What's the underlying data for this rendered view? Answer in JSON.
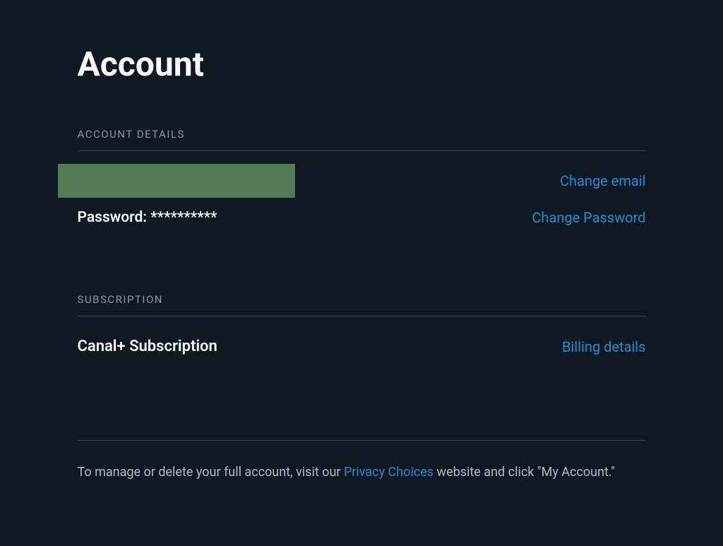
{
  "page": {
    "title": "Account"
  },
  "sections": {
    "accountDetails": {
      "header": "ACCOUNT DETAILS",
      "passwordLabel": "Password: **********",
      "changeEmailLink": "Change email",
      "changePasswordLink": "Change Password"
    },
    "subscription": {
      "header": "SUBSCRIPTION",
      "name": "Canal+ Subscription",
      "billingDetailsLink": "Billing details"
    }
  },
  "footer": {
    "textBefore": "To manage or delete your full account, visit our ",
    "privacyLink": "Privacy Choices",
    "textAfter": " website and click \"My Account.\""
  }
}
